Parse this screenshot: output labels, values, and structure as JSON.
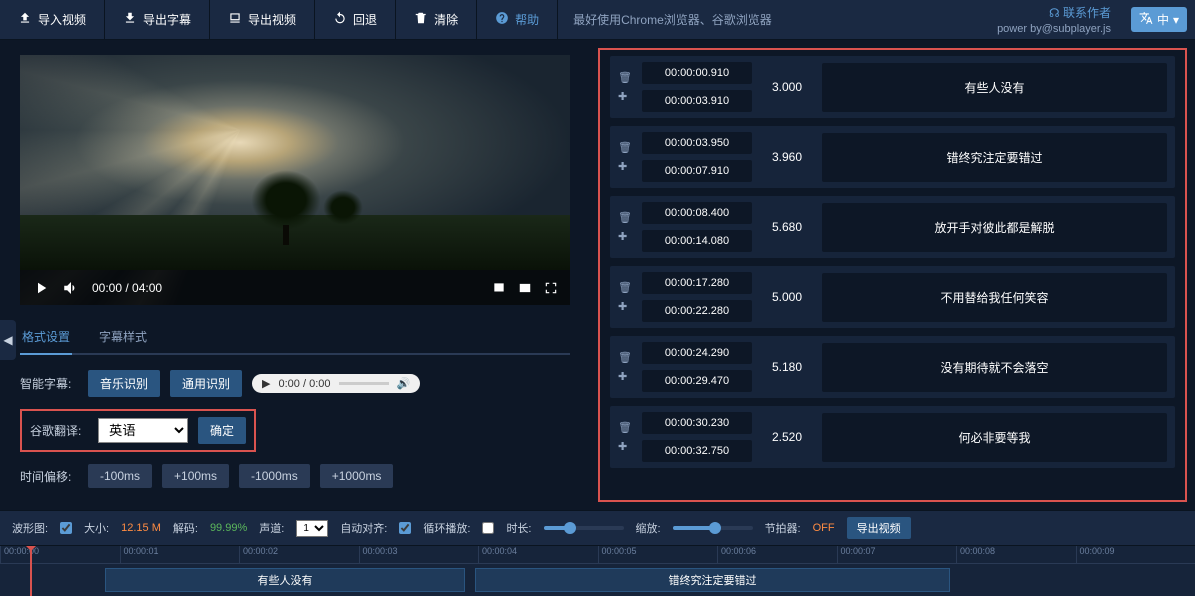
{
  "toolbar": {
    "import_video": "导入视频",
    "export_subtitle": "导出字幕",
    "export_video": "导出视频",
    "undo": "回退",
    "clear": "清除",
    "help": "帮助",
    "browser_tip": "最好使用Chrome浏览器、谷歌浏览器",
    "contact": "联系作者",
    "powerby": "power by@subplayer.js",
    "lang": "中"
  },
  "video": {
    "time": "00:00 / 04:00"
  },
  "tabs": {
    "format": "格式设置",
    "style": "字幕样式"
  },
  "form": {
    "smart_label": "智能字幕:",
    "music_rec": "音乐识别",
    "general_rec": "通用识别",
    "audio_time": "0:00 / 0:00",
    "translate_label": "谷歌翻译:",
    "translate_lang": "英语",
    "confirm": "确定",
    "offset_label": "时间偏移:",
    "m100": "-100ms",
    "p100": "+100ms",
    "m1000": "-1000ms",
    "p1000": "+1000ms"
  },
  "subs": [
    {
      "start": "00:00:00.910",
      "end": "00:00:03.910",
      "dur": "3.000",
      "text": "有些人没有"
    },
    {
      "start": "00:00:03.950",
      "end": "00:00:07.910",
      "dur": "3.960",
      "text": "错终究注定要错过"
    },
    {
      "start": "00:00:08.400",
      "end": "00:00:14.080",
      "dur": "5.680",
      "text": "放开手对彼此都是解脱"
    },
    {
      "start": "00:00:17.280",
      "end": "00:00:22.280",
      "dur": "5.000",
      "text": "不用替给我任何笑容"
    },
    {
      "start": "00:00:24.290",
      "end": "00:00:29.470",
      "dur": "5.180",
      "text": "没有期待就不会落空"
    },
    {
      "start": "00:00:30.230",
      "end": "00:00:32.750",
      "dur": "2.520",
      "text": "何必非要等我"
    }
  ],
  "bottom": {
    "wave_label": "波形图:",
    "size_label": "大小:",
    "size_val": "12.15 M",
    "decode_label": "解码:",
    "decode_val": "99.99%",
    "channel_label": "声道:",
    "channel_val": "1",
    "align_label": "自动对齐:",
    "loop_label": "循环播放:",
    "dur_label": "时长:",
    "zoom_label": "缩放:",
    "metro_label": "节拍器:",
    "metro_val": "OFF",
    "export": "导出视频"
  },
  "timeline": {
    "ticks": [
      "00:00:00",
      "00:00:01",
      "00:00:02",
      "00:00:03",
      "00:00:04",
      "00:00:05",
      "00:00:06",
      "00:00:07",
      "00:00:08",
      "00:00:09"
    ],
    "sub1": "有些人没有",
    "sub2": "错终究注定要错过"
  }
}
